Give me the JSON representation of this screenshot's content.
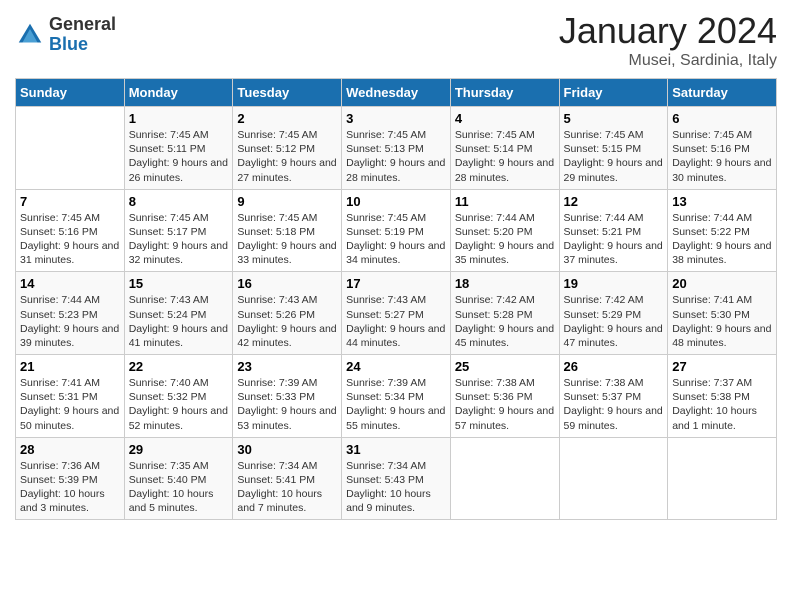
{
  "header": {
    "logo_general": "General",
    "logo_blue": "Blue",
    "month": "January 2024",
    "location": "Musei, Sardinia, Italy"
  },
  "weekdays": [
    "Sunday",
    "Monday",
    "Tuesday",
    "Wednesday",
    "Thursday",
    "Friday",
    "Saturday"
  ],
  "weeks": [
    [
      {
        "day": "",
        "info": ""
      },
      {
        "day": "1",
        "info": "Sunrise: 7:45 AM\nSunset: 5:11 PM\nDaylight: 9 hours and 26 minutes."
      },
      {
        "day": "2",
        "info": "Sunrise: 7:45 AM\nSunset: 5:12 PM\nDaylight: 9 hours and 27 minutes."
      },
      {
        "day": "3",
        "info": "Sunrise: 7:45 AM\nSunset: 5:13 PM\nDaylight: 9 hours and 28 minutes."
      },
      {
        "day": "4",
        "info": "Sunrise: 7:45 AM\nSunset: 5:14 PM\nDaylight: 9 hours and 28 minutes."
      },
      {
        "day": "5",
        "info": "Sunrise: 7:45 AM\nSunset: 5:15 PM\nDaylight: 9 hours and 29 minutes."
      },
      {
        "day": "6",
        "info": "Sunrise: 7:45 AM\nSunset: 5:16 PM\nDaylight: 9 hours and 30 minutes."
      }
    ],
    [
      {
        "day": "7",
        "info": "Sunrise: 7:45 AM\nSunset: 5:16 PM\nDaylight: 9 hours and 31 minutes."
      },
      {
        "day": "8",
        "info": "Sunrise: 7:45 AM\nSunset: 5:17 PM\nDaylight: 9 hours and 32 minutes."
      },
      {
        "day": "9",
        "info": "Sunrise: 7:45 AM\nSunset: 5:18 PM\nDaylight: 9 hours and 33 minutes."
      },
      {
        "day": "10",
        "info": "Sunrise: 7:45 AM\nSunset: 5:19 PM\nDaylight: 9 hours and 34 minutes."
      },
      {
        "day": "11",
        "info": "Sunrise: 7:44 AM\nSunset: 5:20 PM\nDaylight: 9 hours and 35 minutes."
      },
      {
        "day": "12",
        "info": "Sunrise: 7:44 AM\nSunset: 5:21 PM\nDaylight: 9 hours and 37 minutes."
      },
      {
        "day": "13",
        "info": "Sunrise: 7:44 AM\nSunset: 5:22 PM\nDaylight: 9 hours and 38 minutes."
      }
    ],
    [
      {
        "day": "14",
        "info": "Sunrise: 7:44 AM\nSunset: 5:23 PM\nDaylight: 9 hours and 39 minutes."
      },
      {
        "day": "15",
        "info": "Sunrise: 7:43 AM\nSunset: 5:24 PM\nDaylight: 9 hours and 41 minutes."
      },
      {
        "day": "16",
        "info": "Sunrise: 7:43 AM\nSunset: 5:26 PM\nDaylight: 9 hours and 42 minutes."
      },
      {
        "day": "17",
        "info": "Sunrise: 7:43 AM\nSunset: 5:27 PM\nDaylight: 9 hours and 44 minutes."
      },
      {
        "day": "18",
        "info": "Sunrise: 7:42 AM\nSunset: 5:28 PM\nDaylight: 9 hours and 45 minutes."
      },
      {
        "day": "19",
        "info": "Sunrise: 7:42 AM\nSunset: 5:29 PM\nDaylight: 9 hours and 47 minutes."
      },
      {
        "day": "20",
        "info": "Sunrise: 7:41 AM\nSunset: 5:30 PM\nDaylight: 9 hours and 48 minutes."
      }
    ],
    [
      {
        "day": "21",
        "info": "Sunrise: 7:41 AM\nSunset: 5:31 PM\nDaylight: 9 hours and 50 minutes."
      },
      {
        "day": "22",
        "info": "Sunrise: 7:40 AM\nSunset: 5:32 PM\nDaylight: 9 hours and 52 minutes."
      },
      {
        "day": "23",
        "info": "Sunrise: 7:39 AM\nSunset: 5:33 PM\nDaylight: 9 hours and 53 minutes."
      },
      {
        "day": "24",
        "info": "Sunrise: 7:39 AM\nSunset: 5:34 PM\nDaylight: 9 hours and 55 minutes."
      },
      {
        "day": "25",
        "info": "Sunrise: 7:38 AM\nSunset: 5:36 PM\nDaylight: 9 hours and 57 minutes."
      },
      {
        "day": "26",
        "info": "Sunrise: 7:38 AM\nSunset: 5:37 PM\nDaylight: 9 hours and 59 minutes."
      },
      {
        "day": "27",
        "info": "Sunrise: 7:37 AM\nSunset: 5:38 PM\nDaylight: 10 hours and 1 minute."
      }
    ],
    [
      {
        "day": "28",
        "info": "Sunrise: 7:36 AM\nSunset: 5:39 PM\nDaylight: 10 hours and 3 minutes."
      },
      {
        "day": "29",
        "info": "Sunrise: 7:35 AM\nSunset: 5:40 PM\nDaylight: 10 hours and 5 minutes."
      },
      {
        "day": "30",
        "info": "Sunrise: 7:34 AM\nSunset: 5:41 PM\nDaylight: 10 hours and 7 minutes."
      },
      {
        "day": "31",
        "info": "Sunrise: 7:34 AM\nSunset: 5:43 PM\nDaylight: 10 hours and 9 minutes."
      },
      {
        "day": "",
        "info": ""
      },
      {
        "day": "",
        "info": ""
      },
      {
        "day": "",
        "info": ""
      }
    ]
  ]
}
